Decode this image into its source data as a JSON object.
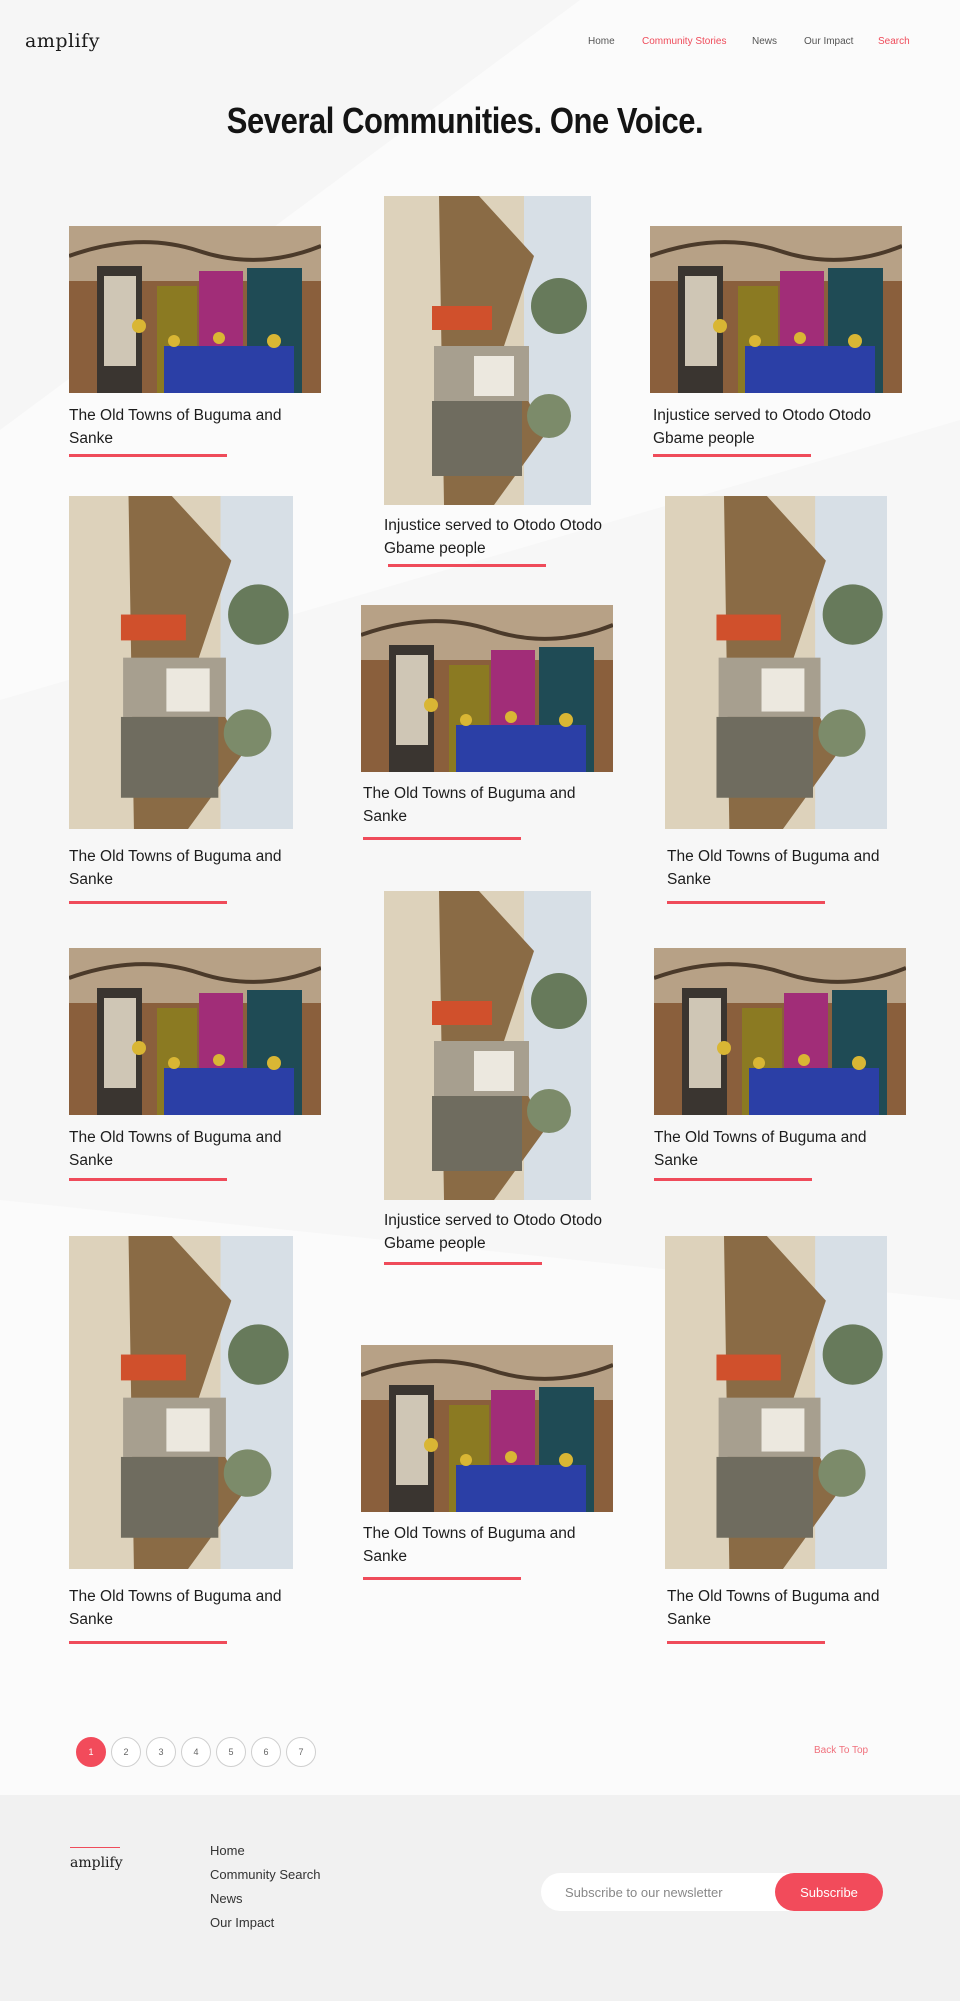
{
  "brand": {
    "logo": "amplify",
    "accent": "#ef4b5a"
  },
  "nav": {
    "items": [
      {
        "label": "Home",
        "active": false
      },
      {
        "label": "Community  Stories",
        "active": true
      },
      {
        "label": "News",
        "active": false
      },
      {
        "label": "Our Impact",
        "active": false
      },
      {
        "label": "Search",
        "active": true
      }
    ]
  },
  "headline": "Several Communities. One Voice.",
  "stories": [
    {
      "title": "The Old Towns of Buguma and Sanke",
      "image": "group-of-women-photo"
    },
    {
      "title": "Injustice served to Otodo Otodo Gbame people",
      "image": "market-stall-photo"
    },
    {
      "title": "Injustice served to Otodo Otodo Gbame people",
      "image": "group-of-women-photo"
    },
    {
      "title": "The Old Towns of Buguma and Sanke",
      "image": "market-stall-photo"
    },
    {
      "title": "The Old Towns of Buguma and Sanke",
      "image": "group-of-women-photo"
    },
    {
      "title": "The Old Towns of Buguma and Sanke",
      "image": "market-stall-photo"
    },
    {
      "title": "The Old Towns of Buguma and Sanke",
      "image": "group-of-women-photo"
    },
    {
      "title": "Injustice served to Otodo Otodo Gbame people",
      "image": "market-stall-photo"
    },
    {
      "title": "The Old Towns of Buguma and Sanke",
      "image": "group-of-women-photo"
    },
    {
      "title": "The Old Towns of Buguma and Sanke",
      "image": "market-stall-photo"
    },
    {
      "title": "The Old Towns of Buguma and Sanke",
      "image": "group-of-women-photo"
    },
    {
      "title": "The Old Towns of Buguma and Sanke",
      "image": "market-stall-photo"
    }
  ],
  "pagination": {
    "pages": [
      "1",
      "2",
      "3",
      "4",
      "5",
      "6",
      "7"
    ],
    "current": "1"
  },
  "back_to_top": "Back To Top",
  "footer": {
    "logo": "amplify",
    "links": [
      "Home",
      "Community Search",
      "News",
      "Our Impact"
    ],
    "newsletter_placeholder": "Subscribe to our newsletter",
    "subscribe_label": "Subscribe"
  }
}
